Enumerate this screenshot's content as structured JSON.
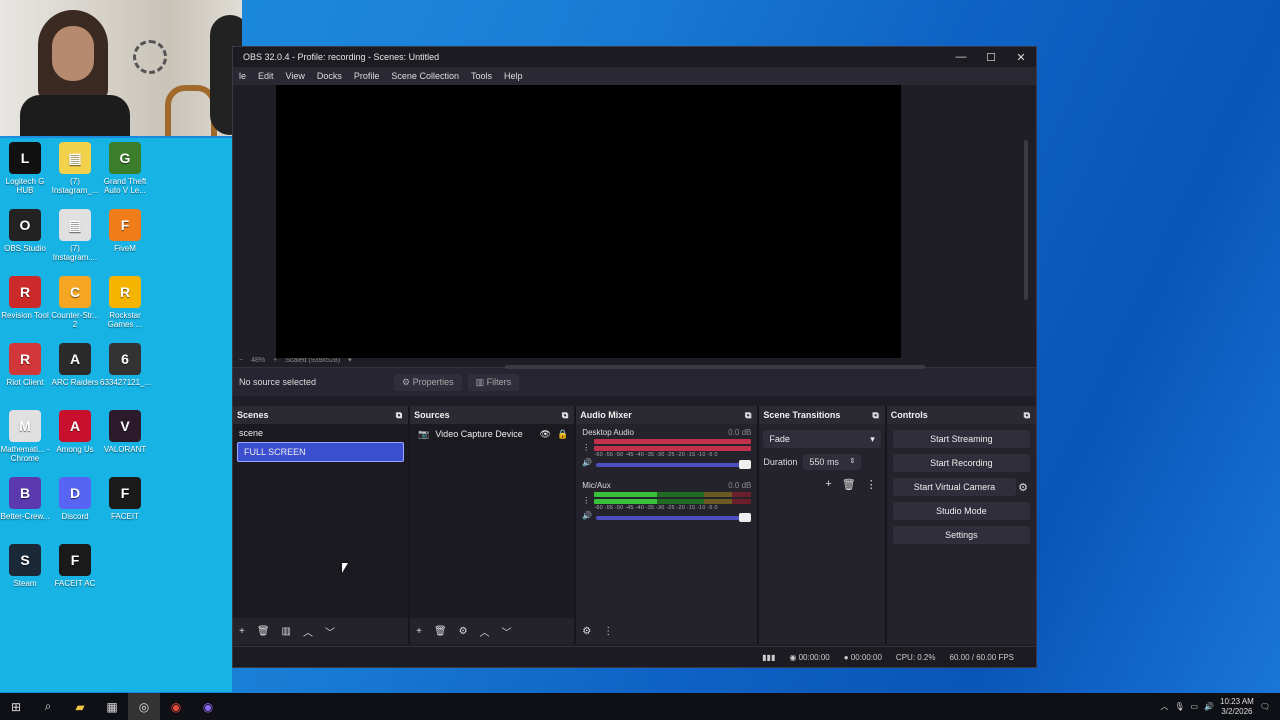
{
  "obs": {
    "title": "OBS 32.0.4 - Profile: recording - Scenes: Untitled",
    "menu": [
      "le",
      "Edit",
      "View",
      "Docks",
      "Profile",
      "Scene Collection",
      "Tools",
      "Help"
    ],
    "zoom": "48%",
    "scaled": "Scaled (939x528)",
    "context": {
      "no_source": "No source selected",
      "properties": "Properties",
      "filters": "Filters"
    },
    "scenes": {
      "title": "Scenes",
      "items": [
        "scene",
        "FULL SCREEN"
      ],
      "selected": 1
    },
    "sources": {
      "title": "Sources",
      "items": [
        "Video Capture Device"
      ]
    },
    "mixer": {
      "title": "Audio Mixer",
      "channels": [
        {
          "name": "Desktop Audio",
          "db": "0.0 dB"
        },
        {
          "name": "Mic/Aux",
          "db": "0.0 dB"
        }
      ],
      "ticks": "-60 -55 -50 -45 -40 -35 -30 -25 -20 -15 -10 -5 0"
    },
    "transitions": {
      "title": "Scene Transitions",
      "type": "Fade",
      "duration_label": "Duration",
      "duration": "550 ms"
    },
    "controls": {
      "title": "Controls",
      "buttons": [
        "Start Streaming",
        "Start Recording",
        "Start Virtual Camera",
        "Studio Mode",
        "Settings"
      ]
    },
    "status": {
      "stream_time": "00:00:00",
      "rec_time": "00:00:00",
      "cpu": "CPU: 0.2%",
      "fps": "60.00 / 60.00 FPS"
    }
  },
  "desktop_icons": [
    {
      "label": "Logitech G HUB",
      "icon": "logitech-icon",
      "color": "#111111"
    },
    {
      "label": "(7) Instagram_...",
      "icon": "file-icon",
      "color": "#f2d14b"
    },
    {
      "label": "Grand Theft Auto V Le...",
      "icon": "gta-icon",
      "color": "#3a7d2a"
    },
    {
      "label": "OBS Studio",
      "icon": "obs-icon",
      "color": "#222222"
    },
    {
      "label": "(7) Instagram....",
      "icon": "chrome-icon",
      "color": "#e0e0e0"
    },
    {
      "label": "FiveM",
      "icon": "fivem-icon",
      "color": "#f07d1a"
    },
    {
      "label": "Revision Tool",
      "icon": "revision-icon",
      "color": "#cc2a2a"
    },
    {
      "label": "Counter-Str... 2",
      "icon": "cs2-icon",
      "color": "#f5a623"
    },
    {
      "label": "Rockstar Games ...",
      "icon": "rockstar-icon",
      "color": "#f4b400"
    },
    {
      "label": "Riot Client",
      "icon": "riot-icon",
      "color": "#d13639"
    },
    {
      "label": "ARC Raiders",
      "icon": "arc-icon",
      "color": "#2b2b2b"
    },
    {
      "label": "633427121_...",
      "icon": "image-icon",
      "color": "#333333"
    },
    {
      "label": "Mathemati... - Chrome",
      "icon": "chrome-icon",
      "color": "#e0e0e0"
    },
    {
      "label": "Among Us",
      "icon": "amongus-icon",
      "color": "#c8102e"
    },
    {
      "label": "VALORANT",
      "icon": "valorant-icon",
      "color": "#2a1a2a"
    },
    {
      "label": "Better-Crew...",
      "icon": "bettercrew-icon",
      "color": "#5b3ab0"
    },
    {
      "label": "Discord",
      "icon": "discord-icon",
      "color": "#5865f2"
    },
    {
      "label": "FACEIT",
      "icon": "faceit-icon",
      "color": "#1a1a1a"
    },
    {
      "label": "Steam",
      "icon": "steam-icon",
      "color": "#1b2838"
    },
    {
      "label": "FACEIT AC",
      "icon": "faceitac-icon",
      "color": "#1a1a1a"
    }
  ],
  "taskbar": {
    "time": "10:23 AM",
    "date": "3/2/2026"
  }
}
